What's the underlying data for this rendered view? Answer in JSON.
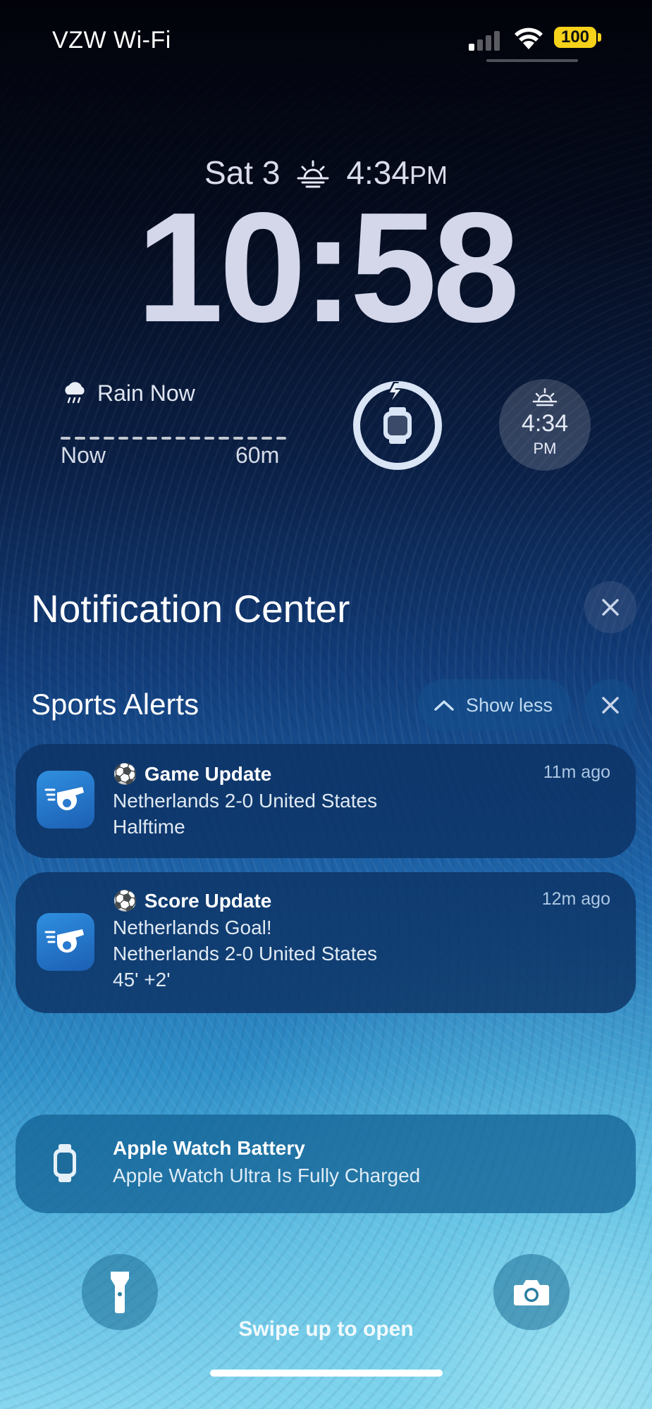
{
  "status_bar": {
    "carrier": "VZW Wi-Fi",
    "signal_bars_active": 1,
    "signal_bars_total": 4,
    "battery": "100",
    "battery_color": "#f6d21a"
  },
  "lock_screen": {
    "date": "Sat 3",
    "sunset_time": "4:34",
    "sunset_ampm": "PM",
    "clock": "10:58"
  },
  "widgets": {
    "rain": {
      "title": "Rain Now",
      "start_label": "Now",
      "end_label": "60m",
      "icon": "cloud-rain-icon"
    },
    "watch_battery": {
      "icon": "apple-watch-charging-icon",
      "level": 1.0
    },
    "sunset": {
      "time": "4:34",
      "ampm": "PM",
      "icon": "sunset-icon"
    }
  },
  "notification_center": {
    "title": "Notification Center",
    "group": {
      "title": "Sports Alerts",
      "show_less_label": "Show less",
      "notifications": [
        {
          "emoji": "⚽",
          "title": "Game Update",
          "time": "11m ago",
          "lines": [
            "Netherlands 2-0 United States",
            "Halftime"
          ]
        },
        {
          "emoji": "⚽",
          "title": "Score Update",
          "time": "12m ago",
          "lines": [
            "Netherlands Goal!",
            "Netherlands 2-0 United States",
            "45' +2'"
          ]
        }
      ]
    },
    "watch_notification": {
      "title": "Apple Watch Battery",
      "body": "Apple Watch Ultra Is Fully Charged"
    }
  },
  "bottom": {
    "swipe_label": "Swipe up to open",
    "left_button": "flashlight-icon",
    "right_button": "camera-icon"
  }
}
